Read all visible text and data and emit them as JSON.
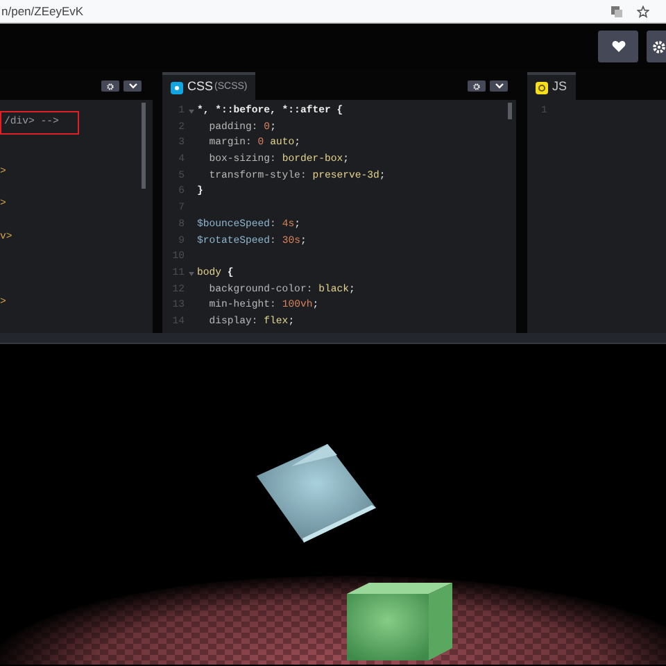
{
  "address_bar": {
    "url": "n/pen/ZEeyEvK"
  },
  "header": {
    "buttons": [
      {
        "kind": "heart"
      },
      {
        "kind": "gear"
      }
    ]
  },
  "html_panel": {
    "lines": [
      {
        "kind": "code",
        "text": "/div> -->",
        "highlighted": true
      },
      {
        "kind": "blank"
      },
      {
        "kind": "blank"
      },
      {
        "kind": "code",
        "text": ">",
        "highlighted": false
      },
      {
        "kind": "blank"
      },
      {
        "kind": "code",
        "text": ">",
        "highlighted": false
      },
      {
        "kind": "blank"
      },
      {
        "kind": "code",
        "text": "v>",
        "highlighted": false
      },
      {
        "kind": "blank"
      },
      {
        "kind": "blank"
      },
      {
        "kind": "blank"
      },
      {
        "kind": "code",
        "text": ">",
        "highlighted": false
      }
    ]
  },
  "css_panel": {
    "tab": {
      "title": "CSS",
      "subtitle": "(SCSS)"
    },
    "lines": [
      {
        "number": "1",
        "foldable": true,
        "tokens": [
          {
            "kind": "selector",
            "text": "*, *::before, *::after {"
          }
        ]
      },
      {
        "number": "2",
        "foldable": false,
        "tokens": [
          {
            "kind": "property",
            "text": "  padding: "
          },
          {
            "kind": "number",
            "text": "0"
          },
          {
            "kind": "punct",
            "text": ";"
          }
        ]
      },
      {
        "number": "3",
        "foldable": false,
        "tokens": [
          {
            "kind": "property",
            "text": "  margin: "
          },
          {
            "kind": "number",
            "text": "0"
          },
          {
            "kind": "value",
            "text": " auto"
          },
          {
            "kind": "punct",
            "text": ";"
          }
        ]
      },
      {
        "number": "4",
        "foldable": false,
        "tokens": [
          {
            "kind": "property",
            "text": "  box-sizing: "
          },
          {
            "kind": "value",
            "text": "border-box"
          },
          {
            "kind": "punct",
            "text": ";"
          }
        ]
      },
      {
        "number": "5",
        "foldable": false,
        "tokens": [
          {
            "kind": "property",
            "text": "  transform-style: "
          },
          {
            "kind": "value",
            "text": "preserve-3d"
          },
          {
            "kind": "punct",
            "text": ";"
          }
        ]
      },
      {
        "number": "6",
        "foldable": false,
        "tokens": [
          {
            "kind": "selector",
            "text": "}"
          }
        ]
      },
      {
        "number": "7",
        "foldable": false
      },
      {
        "number": "8",
        "foldable": false,
        "tokens": [
          {
            "kind": "variable",
            "text": "$bounceSpeed"
          },
          {
            "kind": "property",
            "text": ": "
          },
          {
            "kind": "number",
            "text": "4s"
          },
          {
            "kind": "punct",
            "text": ";"
          }
        ]
      },
      {
        "number": "9",
        "foldable": false,
        "tokens": [
          {
            "kind": "variable",
            "text": "$rotateSpeed"
          },
          {
            "kind": "property",
            "text": ": "
          },
          {
            "kind": "number",
            "text": "30s"
          },
          {
            "kind": "punct",
            "text": ";"
          }
        ]
      },
      {
        "number": "10",
        "foldable": false
      },
      {
        "number": "11",
        "foldable": true,
        "tokens": [
          {
            "kind": "tag",
            "text": "body"
          },
          {
            "kind": "selector",
            "text": " {"
          }
        ]
      },
      {
        "number": "12",
        "foldable": false,
        "tokens": [
          {
            "kind": "property",
            "text": "  background-color: "
          },
          {
            "kind": "value",
            "text": "black"
          },
          {
            "kind": "punct",
            "text": ";"
          }
        ]
      },
      {
        "number": "13",
        "foldable": false,
        "tokens": [
          {
            "kind": "property",
            "text": "  min-height: "
          },
          {
            "kind": "number",
            "text": "100vh"
          },
          {
            "kind": "punct",
            "text": ";"
          }
        ]
      },
      {
        "number": "14",
        "foldable": false,
        "tokens": [
          {
            "kind": "property",
            "text": "  display: "
          },
          {
            "kind": "value",
            "text": "flex"
          },
          {
            "kind": "punct",
            "text": ";"
          }
        ]
      }
    ]
  },
  "js_panel": {
    "tab": {
      "title": "JS"
    },
    "lines": [
      {
        "number": "1"
      }
    ]
  }
}
